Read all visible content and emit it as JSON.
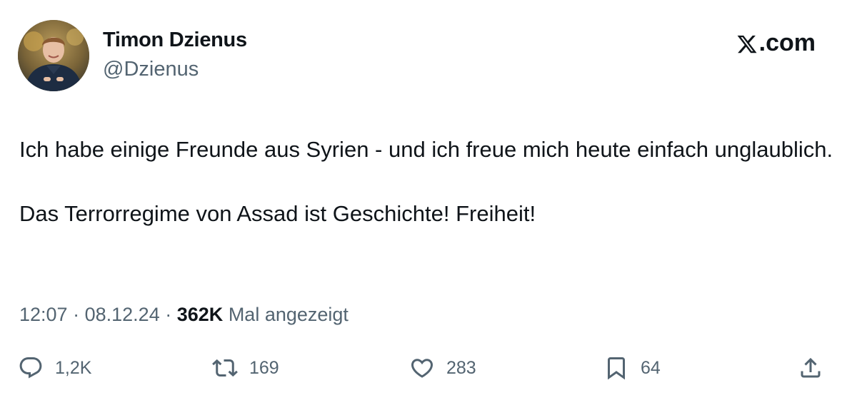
{
  "author": {
    "display_name": "Timon Dzienus",
    "handle": "@Dzienus"
  },
  "brand": {
    "label": ".com",
    "icon": "x-logo-icon"
  },
  "tweet": {
    "paragraphs": [
      "Ich habe einige Freunde aus Syrien - und ich freue mich heute einfach unglaublich.",
      "Das Terrorregime von Assad ist Geschichte! Freiheit!"
    ],
    "time": "12:07",
    "date": "08.12.24",
    "separator": "·",
    "views_count": "362K",
    "views_label": "Mal angezeigt"
  },
  "actions": {
    "reply": {
      "icon": "reply-icon",
      "count": "1,2K"
    },
    "retweet": {
      "icon": "retweet-icon",
      "count": "169"
    },
    "like": {
      "icon": "heart-icon",
      "count": "283"
    },
    "bookmark": {
      "icon": "bookmark-icon",
      "count": "64"
    },
    "share": {
      "icon": "share-icon"
    }
  },
  "colors": {
    "text_primary": "#0f1419",
    "text_secondary": "#536471",
    "background": "#ffffff"
  }
}
